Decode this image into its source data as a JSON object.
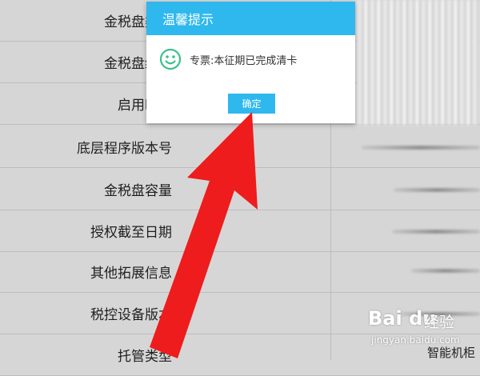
{
  "table": {
    "rows": [
      {
        "label": "金税盘类型"
      },
      {
        "label": "金税盘编号"
      },
      {
        "label": "启用时间"
      },
      {
        "label": "底层程序版本号"
      },
      {
        "label": "金税盘容量"
      },
      {
        "label": "授权截至日期"
      },
      {
        "label": "其他拓展信息"
      },
      {
        "label": "税控设备版本"
      },
      {
        "label": "托管类型",
        "value": "智能机柜"
      }
    ]
  },
  "dialog": {
    "title": "温馨提示",
    "message": "专票:本征期已完成清卡",
    "ok_label": "确定",
    "icon": "smile-icon"
  },
  "watermark": {
    "logo": "Bai du",
    "name": "经验",
    "url": "jingyan.baidu.com"
  },
  "colors": {
    "dialog_accent": "#2fb8ee",
    "smile": "#3cc08a",
    "arrow": "#ee1c1c",
    "background": "#d6d6d6"
  }
}
